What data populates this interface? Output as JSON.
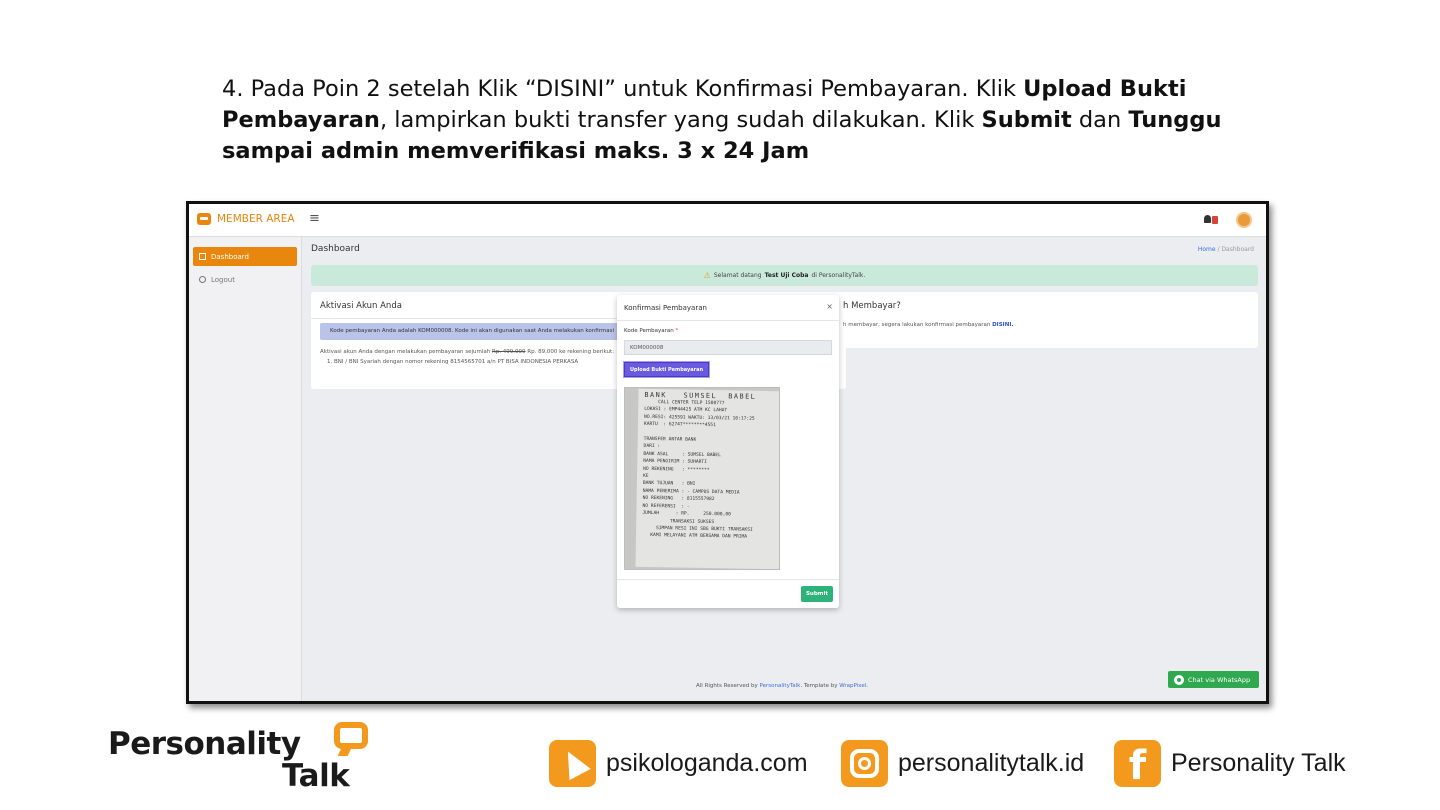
{
  "instruction": {
    "t1": "4. Pada Poin 2 setelah Klik “DISINI” untuk Konfirmasi Pembayaran. Klik ",
    "b1": "Upload Bukti Pembayaran",
    "t2": ", lampirkan bukti transfer yang sudah dilakukan. Klik ",
    "b2": "Submit",
    "t3": " dan ",
    "b3": "Tunggu sampai admin memverifikasi maks. 3 x 24 Jam"
  },
  "app": {
    "brand": "MEMBER AREA",
    "menu_icon": "≡",
    "sidebar": {
      "dashboard": "Dashboard",
      "logout": "Logout"
    },
    "page_title": "Dashboard",
    "breadcrumb": {
      "home": "Home",
      "sep": "/",
      "current": "Dashboard"
    },
    "alert": {
      "pre": "Selamat datang ",
      "name": "Test Uji Coba",
      "post": " di PersonalityTalk."
    },
    "card_left": {
      "title": "Aktivasi Akun Anda",
      "info": "Kode pembayaran Anda adalah KOM000008. Kode ini akan digunakan saat Anda melakukan konfirmasi",
      "para_pre": "Aktivasi akun Anda dengan melakukan pembayaran sejumlah ",
      "price_old": "Rp. 499.000",
      "para_post": " Rp. 89.000 ke rekening berikut:",
      "item": "1. BNI / BNI Syariah dengan nomor rekening 8154565701 a/n PT BISA INDONESIA PERKASA"
    },
    "card_right": {
      "title": "h Membayar?",
      "text_pre": "h membayar, segera lakukan konfirmasi pembayaran ",
      "link": "DISINI."
    },
    "modal": {
      "title": "Konfirmasi Pembayaran",
      "close": "×",
      "label": "Kode Pembayaran",
      "required": "*",
      "value": "KOM000008",
      "upload_button": "Upload Bukti Pembayaran",
      "submit_button": "Submit",
      "receipt_title": "BANK   SUMSEL  BABEL",
      "receipt_lines": "     CALL CENTER TELP 1500777\nLOKASI : EMP44425 ATM KC LAHAT\nNO.RESI: 425591 WAKTU: 13/03/21 10:17:25\nKARTU  : 62747********4551\n\nTRANSFER ANTAR BANK\nDARI :\nBANK ASAL     : SUMSEL BABEL\nNAMA PENGIRIM : SUHARTI\nNO REKENING   : ********\nKE\nBANK TUJUAN   : BNI\nNAMA PENERIMA : - CAMPUS DATA MEDIA\nNO REKENING   : 8115557982\nNO REFERENSI  : -\nJUMLAH      : RP.     250.000,00\n          TRANSAKSI SUKSES\n     SIMPAN RESI INI SBG BUKTI TRANSAKSI\n   KAMI MELAYANI ATM BERSAMA DAN PRIMA"
    },
    "footer": {
      "pre": "All Rights Reserved by ",
      "brand": "PersonalityTalk",
      "mid": ". Template by ",
      "tpl": "WrapPixel",
      "end": "."
    },
    "whatsapp_button": "Chat via WhatsApp"
  },
  "branding": {
    "logo_line1": "Personality",
    "logo_line2": "Talk",
    "website": "psikologanda.com",
    "instagram": "personalitytalk.id",
    "facebook": "Personality Talk",
    "facebook_glyph": "f"
  },
  "colors": {
    "accent": "#f39a1e",
    "modal_upload": "#6a5ae0",
    "submit": "#2db37a",
    "alert_bg": "#c9eadb"
  }
}
